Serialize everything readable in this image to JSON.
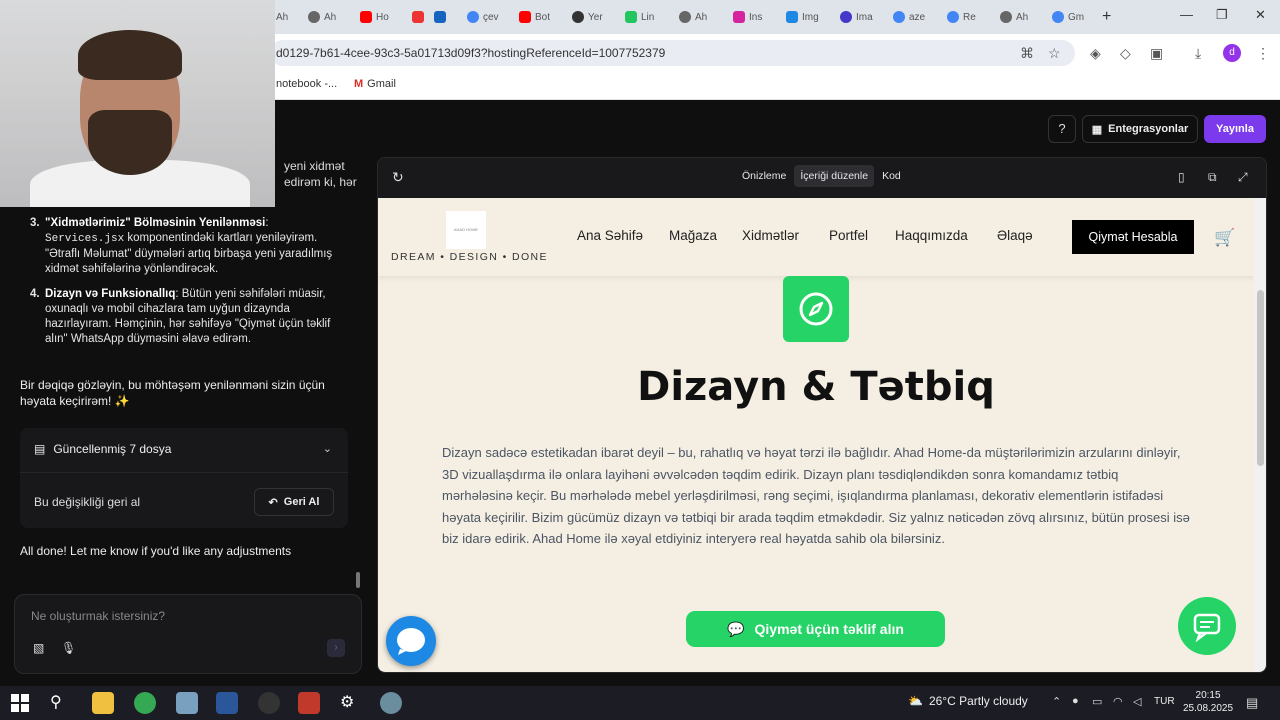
{
  "browser": {
    "url": "d0129-7b61-4cee-93c3-5a01713d09f3?hostingReferenceId=1007752379",
    "bookmarks": [
      "notebook -...",
      "Gmail"
    ],
    "tabs": [
      "Ah",
      "Ah",
      "Ho",
      "",
      "çev",
      "Bot",
      "Yer",
      "Lin",
      "Ah",
      "Ins",
      "Img",
      "Ima",
      "aze",
      "Re",
      "Ah",
      "Gm"
    ],
    "avatar_letter": "d"
  },
  "app": {
    "integrations_label": "Entegrasyonlar",
    "publish_label": "Yayınla",
    "help_icon": "?"
  },
  "chat": {
    "partial_lines": [
      "yeni xidmət",
      "edirəm ki, hər"
    ],
    "items": [
      {
        "num": "3.",
        "title": "\"Xidmətlərimiz\" Bölməsinin Yenilənməsi",
        "code": "Services.jsx",
        "text_before": "",
        "text_after": " komponentindəki kartları yeniləyirəm. \"Ətraflı Məlumat\" düymələri artıq birbaşa yeni yaradılmış xidmət səhifələrinə yönləndirəcək."
      },
      {
        "num": "4.",
        "title": "Dizayn və Funksionallıq",
        "code": "",
        "text_before": ": Bütün yeni səhifələri müasir, oxunaqlı və mobil cihazlara tam uyğun dizaynda hazırlayıram. Həmçinin, hər səhifəyə \"Qiymət üçün təklif alın\" WhatsApp düyməsini əlavə edirəm.",
        "text_after": ""
      }
    ],
    "paragraph": "Bir dəqiqə gözləyin, bu möhtəşəm yenilənməni sizin üçün həyata keçirirəm! ✨",
    "files_label": "Güncellenmiş 7 dosya",
    "revert_label": "Bu değişikliği geri al",
    "revert_button": "Geri Al",
    "done_message": "All done! Let me know if you'd like any adjustments",
    "input_placeholder": "Ne oluşturmak istersiniz?"
  },
  "preview": {
    "tabs": [
      "Önizleme",
      "İçeriği düzenle",
      "Kod"
    ],
    "active_tab": "İçeriği düzenle"
  },
  "site": {
    "logo_text": "AHAD HOME",
    "tagline": "DREAM • DESIGN • DONE",
    "nav": [
      "Ana Səhifə",
      "Mağaza",
      "Xidmətlər",
      "Portfel",
      "Haqqımızda",
      "Əlaqə"
    ],
    "quote_button": "Qiymət Hesabla",
    "heading": "Dizayn & Tətbiq",
    "body": "Dizayn sadəcə estetikadan ibarət deyil – bu, rahatlıq və həyat tərzi ilə bağlıdır. Ahad Home-da müştərilərimizin arzularını dinləyir, 3D vizuallaşdırma ilə onlara layihəni əvvəlcədən təqdim edirik. Dizayn planı təsdiqləndikdən sonra komandamız tətbiq mərhələsinə keçir. Bu mərhələdə mebel yerləşdirilməsi, rəng seçimi, işıqlandırma planlaması, dekorativ elementlərin istifadəsi həyata keçirilir. Bizim gücümüz dizayn və tətbiqi bir arada təqdim etməkdədir. Siz yalnız nəticədən zövq alırsınız, bütün prosesi isə biz idarə edirik. Ahad Home ilə xəyal etdiyiniz interyerə real həyatda sahib ola bilərsiniz.",
    "cta": "Qiymət üçün təklif alın",
    "accent_color": "#25d366"
  },
  "taskbar": {
    "weather": "26°C  Partly cloudy",
    "lang": "TUR",
    "time": "20:15",
    "date": "25.08.2025"
  }
}
